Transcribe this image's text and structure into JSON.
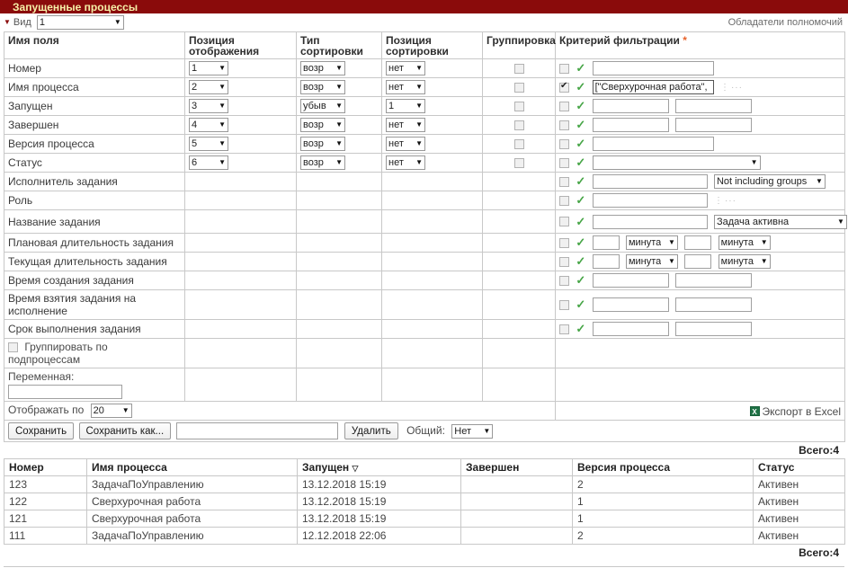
{
  "window": {
    "title": "Запущенные процессы"
  },
  "viewbar": {
    "toggle_icon": "triangle-down-icon",
    "label": "Вид",
    "selected_view": "1",
    "powers_link": "Обладатели полномочий"
  },
  "settings_table": {
    "headers": [
      "Имя поля",
      "Позиция отображения",
      "Тип сортировки",
      "Позиция сортировки",
      "Группировка",
      "Критерий фильтрации"
    ],
    "header_lines": {
      "field_name": "Имя поля",
      "display_position_1": "Позиция",
      "display_position_2": "отображения",
      "sort_type_1": "Тип",
      "sort_type_2": "сортировки",
      "sort_position_1": "Позиция",
      "sort_position_2": "сортировки",
      "grouping": "Группировка",
      "filter_criteria": "Критерий фильтрации",
      "filter_required_mark": "*"
    },
    "rows": [
      {
        "field": "Номер",
        "display_position": "1",
        "sort_type": "возр",
        "sort_position": "нет",
        "grouping_checked": false,
        "filter_checked": false,
        "filter_value": "",
        "filter_kind": "single"
      },
      {
        "field": "Имя процесса",
        "display_position": "2",
        "sort_type": "возр",
        "sort_position": "нет",
        "grouping_checked": false,
        "filter_checked": true,
        "filter_value": "[\"Сверхурочная работа\",",
        "filter_kind": "single-dots"
      },
      {
        "field": "Запущен",
        "display_position": "3",
        "sort_type": "убыв",
        "sort_position": "1",
        "grouping_checked": false,
        "filter_checked": false,
        "filter_value": "",
        "filter_value2": "",
        "filter_kind": "range"
      },
      {
        "field": "Завершен",
        "display_position": "4",
        "sort_type": "возр",
        "sort_position": "нет",
        "grouping_checked": false,
        "filter_checked": false,
        "filter_value": "",
        "filter_value2": "",
        "filter_kind": "range"
      },
      {
        "field": "Версия процесса",
        "display_position": "5",
        "sort_type": "возр",
        "sort_position": "нет",
        "grouping_checked": false,
        "filter_checked": false,
        "filter_value": "",
        "filter_kind": "single"
      },
      {
        "field": "Статус",
        "display_position": "6",
        "sort_type": "возр",
        "sort_position": "нет",
        "grouping_checked": false,
        "filter_checked": false,
        "filter_select_value": "",
        "filter_kind": "select"
      },
      {
        "field": "Исполнитель задания",
        "display_position": "",
        "sort_type": "",
        "sort_position": "",
        "grouping_checked": null,
        "filter_checked": false,
        "filter_value": "",
        "filter_select_value": "Not including groups",
        "filter_kind": "text-plus-select"
      },
      {
        "field": "Роль",
        "display_position": "",
        "sort_type": "",
        "sort_position": "",
        "grouping_checked": null,
        "filter_checked": false,
        "filter_value": "",
        "filter_kind": "text-plus-dots"
      },
      {
        "field": "Название задания",
        "display_position": "",
        "sort_type": "",
        "sort_position": "",
        "grouping_checked": null,
        "filter_checked": false,
        "filter_value": "",
        "filter_select_value": "Задача активна",
        "filter_kind": "text-plus-select-wide"
      },
      {
        "field": "Плановая длительность задания",
        "display_position": "",
        "sort_type": "",
        "sort_position": "",
        "grouping_checked": null,
        "filter_checked": false,
        "filter_value": "",
        "filter_value2": "",
        "unit1": "минута",
        "unit2": "минута",
        "filter_kind": "duration"
      },
      {
        "field": "Текущая длительность задания",
        "display_position": "",
        "sort_type": "",
        "sort_position": "",
        "grouping_checked": null,
        "filter_checked": false,
        "filter_value": "",
        "filter_value2": "",
        "unit1": "минута",
        "unit2": "минута",
        "filter_kind": "duration"
      },
      {
        "field": "Время создания задания",
        "display_position": "",
        "sort_type": "",
        "sort_position": "",
        "grouping_checked": null,
        "filter_checked": false,
        "filter_value": "",
        "filter_value2": "",
        "filter_kind": "range"
      },
      {
        "field": "Время взятия задания на исполнение",
        "display_position": "",
        "sort_type": "",
        "sort_position": "",
        "grouping_checked": null,
        "filter_checked": false,
        "filter_value": "",
        "filter_value2": "",
        "filter_kind": "range"
      },
      {
        "field": "Срок выполнения задания",
        "display_position": "",
        "sort_type": "",
        "sort_position": "",
        "grouping_checked": null,
        "filter_checked": false,
        "filter_value": "",
        "filter_value2": "",
        "filter_kind": "range"
      }
    ],
    "group_subprocess": {
      "label": "Группировать по подпроцессам",
      "checked": false
    },
    "variable": {
      "label": "Переменная:",
      "value": ""
    }
  },
  "footer": {
    "show_by_label": "Отображать по",
    "show_by_value": "20",
    "save_label": "Сохранить",
    "save_as_label": "Сохранить как...",
    "name_value": "",
    "delete_label": "Удалить",
    "shared_label": "Общий:",
    "shared_value": "Нет",
    "export_icon": "excel-icon",
    "export_icon_glyph": "X",
    "export_label": "Экспорт в Excel"
  },
  "totals": {
    "top": "Всего:4",
    "bottom": "Всего:4"
  },
  "results_table": {
    "columns": [
      "Номер",
      "Имя процесса",
      "Запущен",
      "Завершен",
      "Версия процесса",
      "Статус"
    ],
    "sorted_column": "Запущен",
    "sort_glyph": "▽",
    "rows": [
      {
        "number": "123",
        "process_name": "ЗадачаПоУправлению",
        "started": "13.12.2018 15:19",
        "finished": "",
        "version": "2",
        "status": "Активен"
      },
      {
        "number": "122",
        "process_name": "Сверхурочная работа",
        "started": "13.12.2018 15:19",
        "finished": "",
        "version": "1",
        "status": "Активен"
      },
      {
        "number": "121",
        "process_name": "Сверхурочная работа",
        "started": "13.12.2018 15:19",
        "finished": "",
        "version": "1",
        "status": "Активен"
      },
      {
        "number": "111",
        "process_name": "ЗадачаПоУправлению",
        "started": "12.12.2018 22:06",
        "finished": "",
        "version": "2",
        "status": "Активен"
      }
    ]
  },
  "colors": {
    "titlebar_bg": "#8a0b0b",
    "titlebar_text": "#f6f0a8",
    "required_star": "#e8622a",
    "tick_green": "#46a546",
    "excel_green": "#1e7145",
    "border": "#c8c8c8"
  }
}
